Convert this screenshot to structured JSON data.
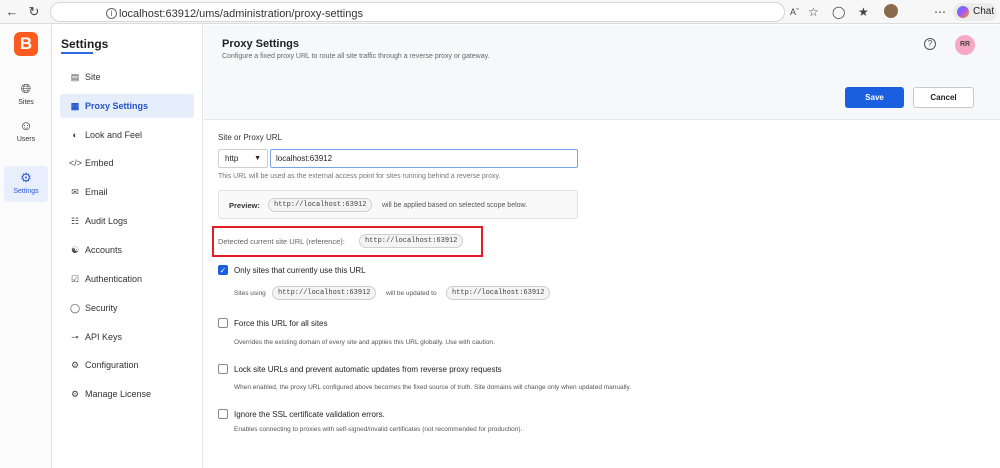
{
  "browser": {
    "url": "localhost:63912/ums/administration/proxy-settings",
    "chat_label": "Chat"
  },
  "rail": {
    "logo_letter": "B",
    "items": [
      {
        "label": "Sites",
        "icon": "globe-icon"
      },
      {
        "label": "Users",
        "icon": "users-icon"
      },
      {
        "label": "Settings",
        "icon": "gear-icon"
      }
    ]
  },
  "sidebar": {
    "title": "Settings",
    "items": [
      {
        "label": "Site",
        "icon": "site-icon"
      },
      {
        "label": "Proxy Settings",
        "icon": "proxy-icon"
      },
      {
        "label": "Look and Feel",
        "icon": "palette-icon"
      },
      {
        "label": "Embed",
        "icon": "code-icon"
      },
      {
        "label": "Email",
        "icon": "mail-icon"
      },
      {
        "label": "Audit Logs",
        "icon": "log-icon"
      },
      {
        "label": "Accounts",
        "icon": "account-icon"
      },
      {
        "label": "Authentication",
        "icon": "lock-icon"
      },
      {
        "label": "Security",
        "icon": "shield-icon"
      },
      {
        "label": "API Keys",
        "icon": "key-icon"
      },
      {
        "label": "Configuration",
        "icon": "config-icon"
      },
      {
        "label": "Manage License",
        "icon": "license-icon"
      }
    ]
  },
  "header": {
    "title": "Proxy Settings",
    "subtitle": "Configure a fixed proxy URL to route all site traffic through a reverse proxy or gateway.",
    "avatar": "RR",
    "save_label": "Save",
    "cancel_label": "Cancel"
  },
  "form": {
    "url_label": "Site or Proxy URL",
    "protocol": "http",
    "url_value": "localhost:63912",
    "url_help": "This URL will be used as the external access point for sites running behind a reverse proxy.",
    "preview_label": "Preview:",
    "preview_url": "http://localhost:63912",
    "preview_suffix": "will be applied based on selected scope below.",
    "detected_label": "Detected current site URL (reference):",
    "detected_url": "http://localhost:63912"
  },
  "options": [
    {
      "label": "Only sites that currently use this URL",
      "checked": true,
      "desc_prefix": "Sites using",
      "desc_from": "http://localhost:63912",
      "desc_mid": "will be updated to",
      "desc_to": "http://localhost:63912"
    },
    {
      "label": "Force this URL for all sites",
      "checked": false,
      "desc": "Overrides the existing domain of every site and applies this URL globally. Use with caution."
    },
    {
      "label": "Lock site URLs and prevent automatic updates from reverse proxy requests",
      "checked": false,
      "desc": "When enabled, the proxy URL configured above becomes the fixed source of truth. Site domains will change only when updated manually."
    },
    {
      "label": "Ignore the SSL certificate validation errors.",
      "checked": false,
      "desc": "Enables connecting to proxies with self-signed/invalid certificates (not recommended for production)."
    }
  ],
  "colors": {
    "accent": "#1a5fe0",
    "brand": "#ff5a1f",
    "highlight": "#e11d2a"
  }
}
